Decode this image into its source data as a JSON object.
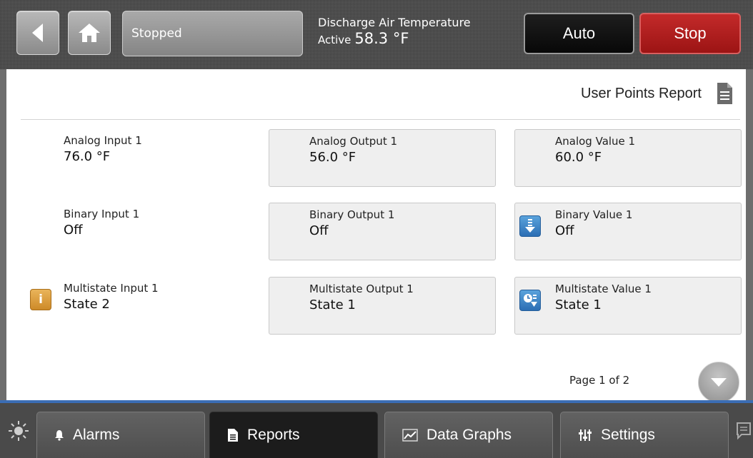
{
  "topbar": {
    "status": "Stopped",
    "temp_title": "Discharge Air Temperature",
    "temp_state": "Active",
    "temp_value": "58.3 °F",
    "auto_label": "Auto",
    "stop_label": "Stop"
  },
  "report": {
    "title": "User Points Report"
  },
  "points": [
    {
      "name": "Analog Input 1",
      "value": "76.0 °F"
    },
    {
      "name": "Analog Output 1",
      "value": "56.0 °F"
    },
    {
      "name": "Analog Value 1",
      "value": "60.0 °F"
    },
    {
      "name": "Binary Input 1",
      "value": "Off"
    },
    {
      "name": "Binary Output 1",
      "value": "Off"
    },
    {
      "name": "Binary Value 1",
      "value": "Off"
    },
    {
      "name": "Multistate Input 1",
      "value": "State 2"
    },
    {
      "name": "Multistate Output 1",
      "value": "State 1"
    },
    {
      "name": "Multistate Value 1",
      "value": "State 1"
    }
  ],
  "pagination": {
    "label": "Page 1 of 2"
  },
  "nav": {
    "tabs": [
      {
        "label": "Alarms",
        "icon": "bell-icon"
      },
      {
        "label": "Reports",
        "icon": "document-icon"
      },
      {
        "label": "Data Graphs",
        "icon": "graph-icon"
      },
      {
        "label": "Settings",
        "icon": "sliders-icon"
      }
    ],
    "active_tab": "Reports"
  },
  "colors": {
    "stop_button": "#b01f1f",
    "nav_accent": "#3b6db4",
    "info_icon": "#d99a3a",
    "override_icon": "#3d86c8"
  }
}
